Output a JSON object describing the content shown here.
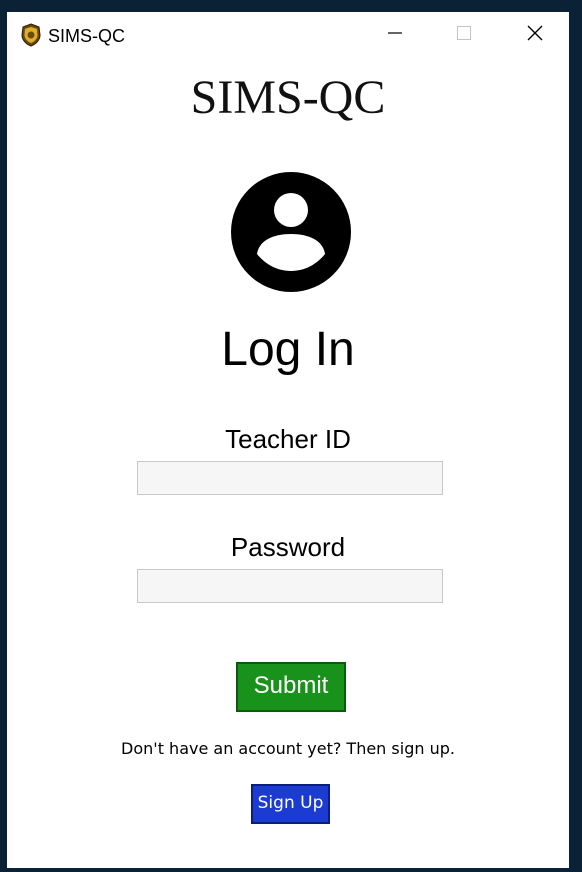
{
  "window": {
    "title": "SIMS-QC",
    "app_icon": "badge-icon",
    "controls": {
      "minimize_icon": "minimize-icon",
      "maximize_icon": "maximize-icon",
      "close_icon": "close-icon"
    }
  },
  "main": {
    "heading": "SIMS-QC",
    "avatar_icon": "user-circle-icon",
    "login_title": "Log In",
    "teacher_id": {
      "label": "Teacher ID",
      "value": "",
      "placeholder": ""
    },
    "password": {
      "label": "Password",
      "value": "",
      "placeholder": ""
    },
    "submit_label": "Submit",
    "signup_prompt": "Don't have an account yet? Then sign up.",
    "signup_label": "Sign Up"
  },
  "colors": {
    "submit_bg": "#18921a",
    "signup_bg": "#1c3bd0",
    "desktop_bg": "#0b2236"
  }
}
